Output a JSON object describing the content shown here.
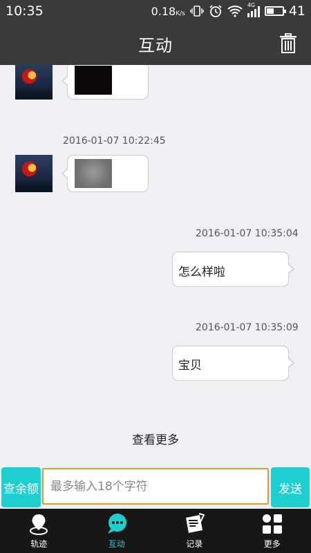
{
  "status_bar": {
    "time": "10:35",
    "speed": "0.18",
    "speed_unit": "K/s",
    "network": "4G",
    "battery": "41"
  },
  "header": {
    "title": "互动"
  },
  "messages": [
    {
      "timestamp": "2016-01-07 10:22:45"
    },
    {
      "timestamp": "2016-01-07 10:35:04",
      "text": "怎么样啦"
    },
    {
      "timestamp": "2016-01-07 10:35:09",
      "text": "宝贝"
    }
  ],
  "load_more": "查看更多",
  "input_bar": {
    "balance_label": "查余额",
    "placeholder": "最多输入18个字符",
    "send_label": "发送"
  },
  "tabs": [
    {
      "label": "轨迹",
      "icon": "location-pin-icon"
    },
    {
      "label": "互动",
      "icon": "chat-bubbles-icon"
    },
    {
      "label": "记录",
      "icon": "document-icon"
    },
    {
      "label": "更多",
      "icon": "grid-icon"
    }
  ],
  "colors": {
    "accent": "#1fcfd0",
    "input_border": "#e09a35",
    "header_bg": "#3a3a3a",
    "tabbar_bg": "#171717"
  }
}
